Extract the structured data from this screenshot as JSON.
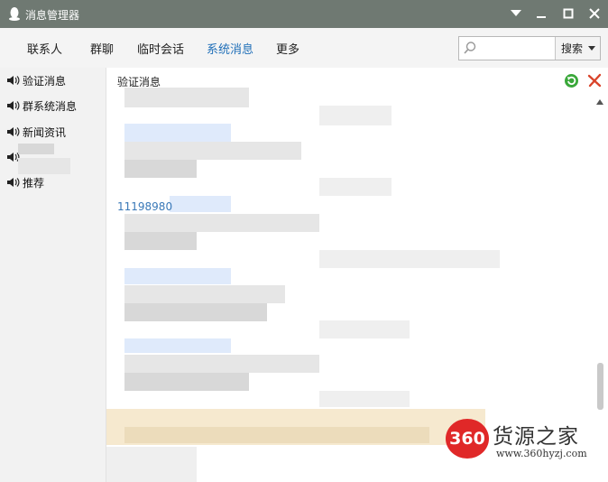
{
  "window": {
    "title": "消息管理器"
  },
  "tabs": [
    {
      "label": "联系人"
    },
    {
      "label": "群聊"
    },
    {
      "label": "临时会话"
    },
    {
      "label": "系统消息",
      "active": true
    },
    {
      "label": "更多"
    }
  ],
  "search": {
    "placeholder": "",
    "button_label": "搜索"
  },
  "sidebar": {
    "items": [
      {
        "label": "验证消息",
        "icon": "speaker-icon"
      },
      {
        "label": "群系统消息",
        "icon": "speaker-icon"
      },
      {
        "label": "新闻资讯",
        "icon": "speaker-icon"
      },
      {
        "label": "",
        "icon": "speaker-icon"
      },
      {
        "label": "推荐",
        "icon": "speaker-icon"
      }
    ]
  },
  "content": {
    "heading": "验证消息",
    "visible_id": "11198980"
  },
  "watermark": {
    "text": "货源之家",
    "badge": "360",
    "url": "www.360hyzj.com"
  },
  "colors": {
    "titlebar": "#6f7972",
    "active_tab": "#1f6fb8",
    "link": "#3a79b8"
  }
}
